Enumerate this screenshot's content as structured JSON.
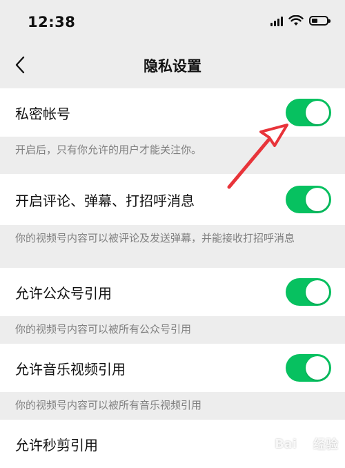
{
  "status_bar": {
    "time": "12:38",
    "icons": [
      "signal-icon",
      "wifi-icon",
      "battery-icon"
    ]
  },
  "nav": {
    "back_icon": "chevron-left-icon",
    "title": "隐私设置"
  },
  "settings": [
    {
      "label": "私密帐号",
      "enabled": true,
      "description": "开启后，只有你允许的用户才能关注你。"
    },
    {
      "label": "开启评论、弹幕、打招呼消息",
      "enabled": true,
      "description": "你的视频号内容可以被评论及发送弹幕，并能接收打招呼消息"
    },
    {
      "label": "允许公众号引用",
      "enabled": true,
      "description": "你的视频号内容可以被所有公众号引用"
    },
    {
      "label": "允许音乐视频引用",
      "enabled": true,
      "description": "你的视频号内容可以被所有音乐视频引用"
    },
    {
      "label": "允许秒剪引用"
    }
  ],
  "colors": {
    "toggle_on": "#07c160",
    "page_bg": "#ededed",
    "row_bg": "#ffffff",
    "desc_text": "#7f7f7f",
    "annotation_arrow": "#e8343a"
  },
  "watermark": {
    "text": "Bai 经验"
  }
}
